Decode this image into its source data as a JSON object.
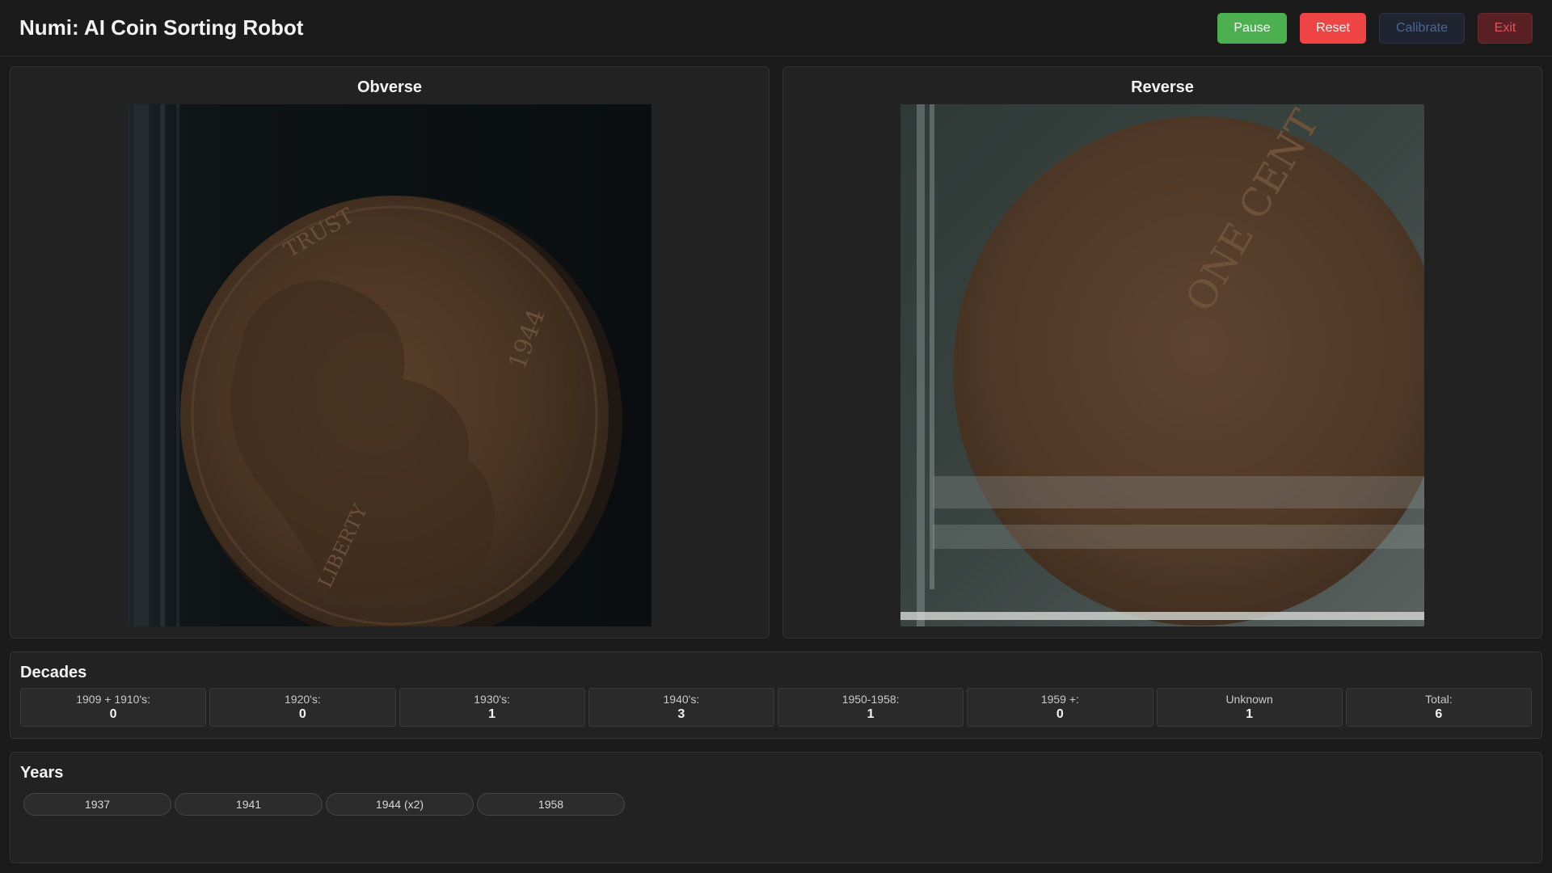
{
  "header": {
    "title": "Numi: AI Coin Sorting Robot",
    "buttons": {
      "pause": "Pause",
      "reset": "Reset",
      "calibrate": "Calibrate",
      "exit": "Exit"
    }
  },
  "images": {
    "obverse": {
      "title": "Obverse",
      "icon": "coin-obverse-photo"
    },
    "reverse": {
      "title": "Reverse",
      "icon": "coin-reverse-photo"
    }
  },
  "decades": {
    "title": "Decades",
    "items": [
      {
        "label": "1909 + 1910's:",
        "value": "0"
      },
      {
        "label": "1920's:",
        "value": "0"
      },
      {
        "label": "1930's:",
        "value": "1"
      },
      {
        "label": "1940's:",
        "value": "3"
      },
      {
        "label": "1950-1958:",
        "value": "1"
      },
      {
        "label": "1959 +:",
        "value": "0"
      },
      {
        "label": "Unknown",
        "value": "1"
      },
      {
        "label": "Total:",
        "value": "6"
      }
    ]
  },
  "years": {
    "title": "Years",
    "items": [
      "1937",
      "1941",
      "1944 (x2)",
      "1958"
    ]
  },
  "colors": {
    "background": "#1b1b1b",
    "panel": "#222222",
    "pause": "#4caf50",
    "reset": "#ef4444",
    "calibrate_text": "#4a6796",
    "exit_text": "#e0555c"
  }
}
